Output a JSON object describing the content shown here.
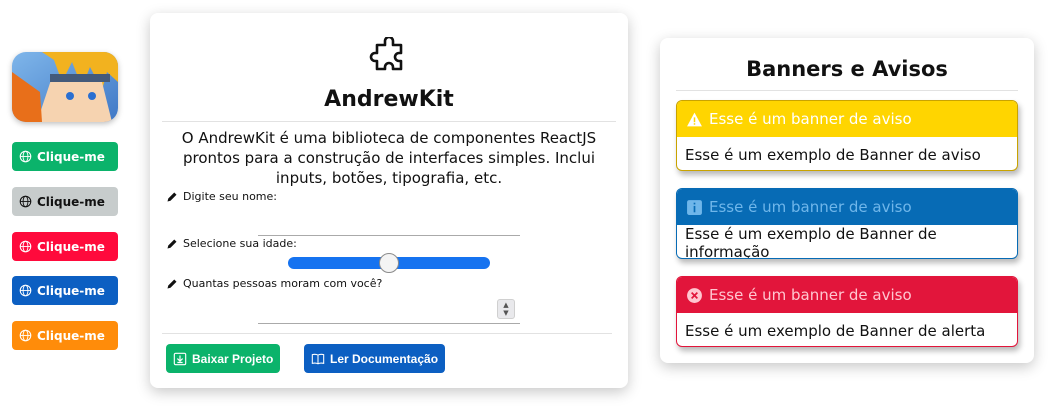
{
  "sidebar": {
    "avatar_alt": "",
    "buttons": [
      {
        "label": "Clique-me",
        "color": "#0bb36b"
      },
      {
        "label": "Clique-me",
        "color": "#c7cccc"
      },
      {
        "label": "Clique-me",
        "color": "#ff0a3c"
      },
      {
        "label": "Clique-me",
        "color": "#0c5fc2"
      },
      {
        "label": "Clique-me",
        "color": "#ff8c0a"
      }
    ]
  },
  "main": {
    "icon": "puzzle-icon",
    "title": "AndrewKit",
    "description": "O AndrewKit é uma biblioteca de componentes ReactJS prontos para a construção de interfaces simples. Inclui inputs, botões, tipografia, etc.",
    "fields": {
      "name_label": "Digite seu nome:",
      "name_value": "",
      "age_label": "Selecione sua idade:",
      "age_value": 50,
      "people_label": "Quantas pessoas moram com você?",
      "people_value": ""
    },
    "actions": {
      "download_label": "Baixar Projeto",
      "download_color": "#0bb36b",
      "docs_label": "Ler Documentação",
      "docs_color": "#0c5fc2"
    }
  },
  "banners": {
    "title": "Banners e Avisos",
    "items": [
      {
        "kind": "warning",
        "icon": "warning-icon",
        "header": "Esse é um banner de aviso",
        "body": "Esse é um exemplo de Banner de aviso",
        "color": "#ffd500",
        "text_color": "#ffffff"
      },
      {
        "kind": "info",
        "icon": "info-icon",
        "header": "Esse é um banner de aviso",
        "body": "Esse é um exemplo de Banner de informação",
        "color": "#076bb5",
        "text_color": "#6fb6ea"
      },
      {
        "kind": "error",
        "icon": "error-icon",
        "header": "Esse é um banner de aviso",
        "body": "Esse é um exemplo de Banner de alerta",
        "color": "#e2153b",
        "text_color": "#ffc6d0"
      }
    ]
  }
}
